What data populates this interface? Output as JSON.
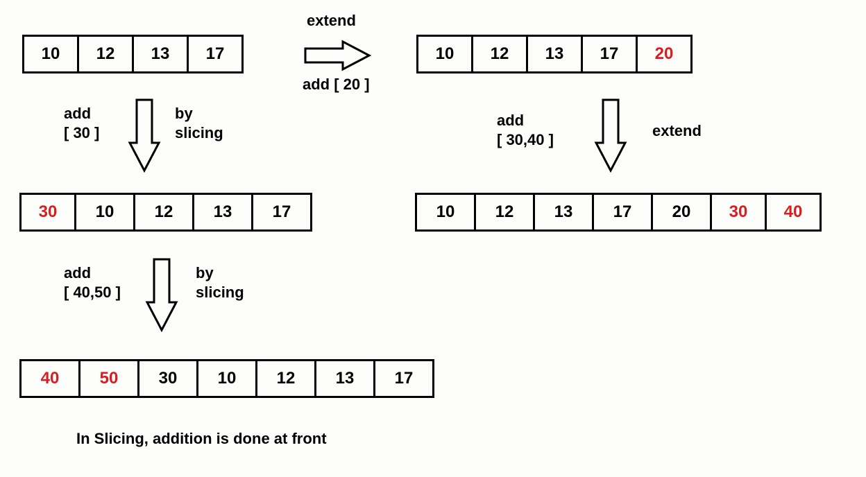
{
  "arrays": {
    "topLeft": [
      {
        "v": "10",
        "red": false
      },
      {
        "v": "12",
        "red": false
      },
      {
        "v": "13",
        "red": false
      },
      {
        "v": "17",
        "red": false
      }
    ],
    "topRight": [
      {
        "v": "10",
        "red": false
      },
      {
        "v": "12",
        "red": false
      },
      {
        "v": "13",
        "red": false
      },
      {
        "v": "17",
        "red": false
      },
      {
        "v": "20",
        "red": true
      }
    ],
    "midLeft": [
      {
        "v": "30",
        "red": true
      },
      {
        "v": "10",
        "red": false
      },
      {
        "v": "12",
        "red": false
      },
      {
        "v": "13",
        "red": false
      },
      {
        "v": "17",
        "red": false
      }
    ],
    "midRight": [
      {
        "v": "10",
        "red": false
      },
      {
        "v": "12",
        "red": false
      },
      {
        "v": "13",
        "red": false
      },
      {
        "v": "17",
        "red": false
      },
      {
        "v": "20",
        "red": false
      },
      {
        "v": "30",
        "red": true
      },
      {
        "v": "40",
        "red": true
      }
    ],
    "bottomLeft": [
      {
        "v": "40",
        "red": true
      },
      {
        "v": "50",
        "red": true
      },
      {
        "v": "30",
        "red": false
      },
      {
        "v": "10",
        "red": false
      },
      {
        "v": "12",
        "red": false
      },
      {
        "v": "13",
        "red": false
      },
      {
        "v": "17",
        "red": false
      }
    ]
  },
  "labels": {
    "extend_top": "extend",
    "add20": "add [ 20 ]",
    "add30": "add\n[ 30 ]",
    "bySlicing": "by\nslicing",
    "add3040": "add\n[ 30,40 ]",
    "extend_mid": "extend",
    "add4050": "add\n[ 40,50 ]",
    "bySlicing2": "by\nslicing",
    "caption": "In Slicing, addition is done at front"
  },
  "chart_data": {
    "type": "table",
    "title": "Python list extension via extend vs slicing (prepend)",
    "initial": [
      10,
      12,
      13,
      17
    ],
    "paths": [
      {
        "method": "extend",
        "steps": [
          {
            "op": "extend",
            "add": [
              20
            ],
            "result": [
              10,
              12,
              13,
              17,
              20
            ]
          },
          {
            "op": "extend",
            "add": [
              30,
              40
            ],
            "result": [
              10,
              12,
              13,
              17,
              20,
              30,
              40
            ]
          }
        ]
      },
      {
        "method": "slicing (prepend)",
        "steps": [
          {
            "op": "slice-prepend",
            "add": [
              30
            ],
            "result": [
              30,
              10,
              12,
              13,
              17
            ]
          },
          {
            "op": "slice-prepend",
            "add": [
              40,
              50
            ],
            "result": [
              40,
              50,
              30,
              10,
              12,
              13,
              17
            ]
          }
        ]
      }
    ],
    "caption": "In Slicing, addition is done at front"
  }
}
